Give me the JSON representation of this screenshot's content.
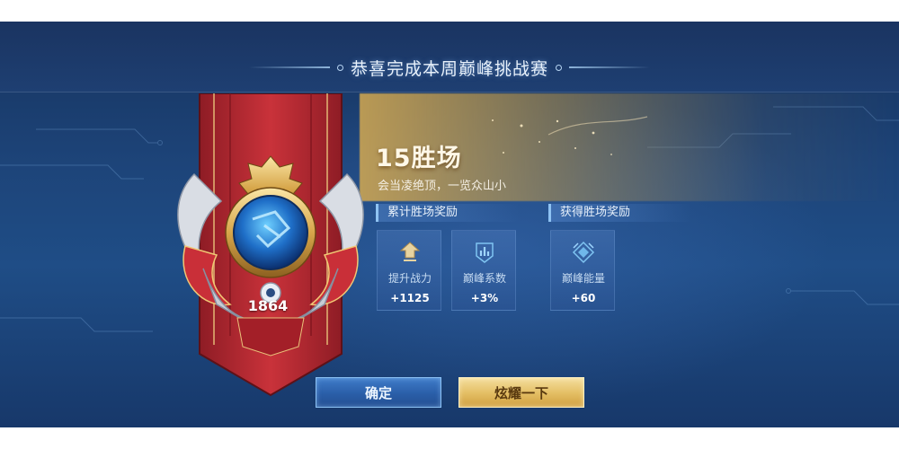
{
  "header": {
    "title": "恭喜完成本周巅峰挑战赛"
  },
  "rank": {
    "score": "1864",
    "badge_icon": "peak-rank-crest-icon"
  },
  "result": {
    "wins_title": "15胜场",
    "subtitle": "会当凌绝顶，一览众山小"
  },
  "sections": {
    "cumulative_label": "累计胜场奖励",
    "earned_label": "获得胜场奖励"
  },
  "rewards": [
    {
      "icon": "combat-power-up-icon",
      "name": "提升战力",
      "value": "+1125"
    },
    {
      "icon": "peak-coefficient-icon",
      "name": "巅峰系数",
      "value": "+3%"
    },
    {
      "icon": "peak-energy-icon",
      "name": "巅峰能量",
      "value": "+60"
    }
  ],
  "buttons": {
    "confirm": "确定",
    "share": "炫耀一下"
  },
  "colors": {
    "background": "#1d4479",
    "gold_accent": "#e3bd62",
    "banner_red": "#b8262f",
    "confirm_blue": "#2a5ea8"
  }
}
